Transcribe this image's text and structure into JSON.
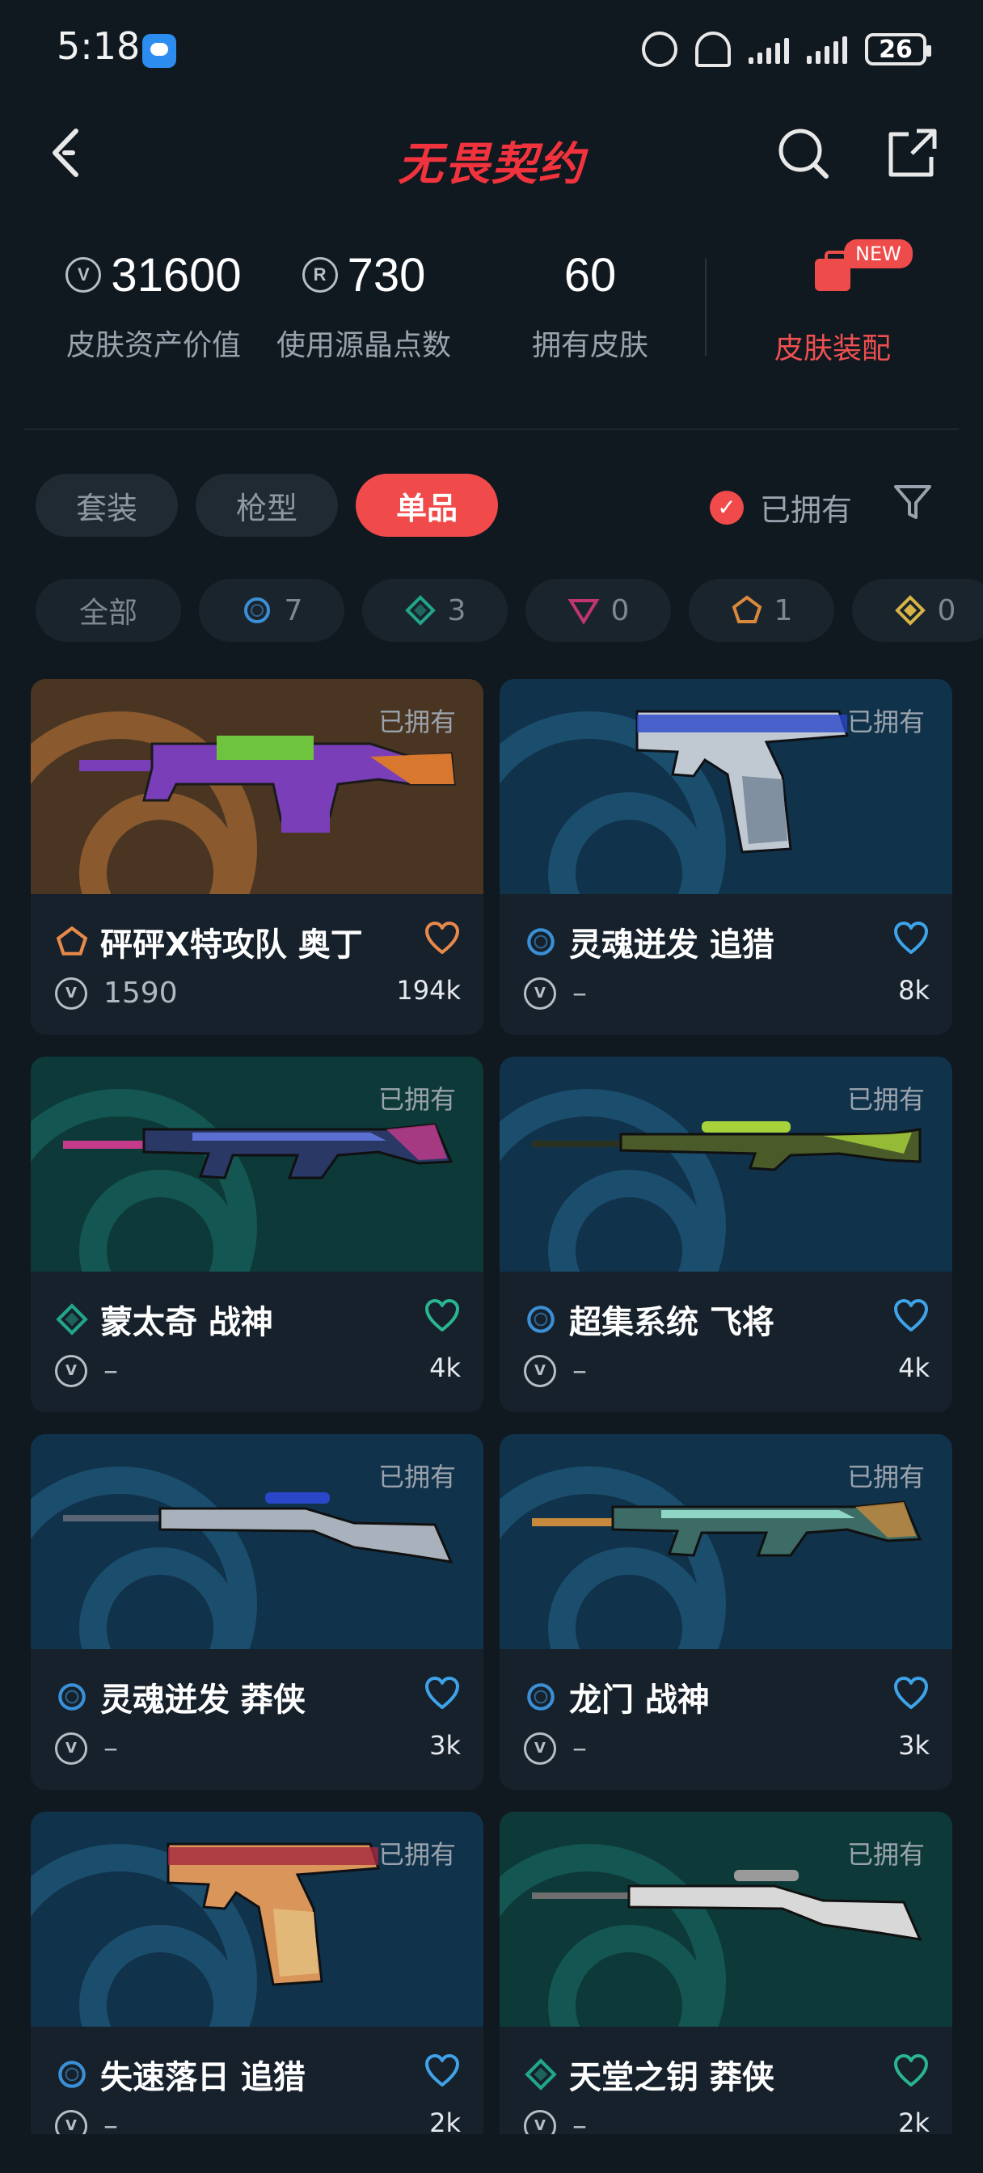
{
  "status_bar": {
    "time": "5:18",
    "battery": "26",
    "network": "3"
  },
  "header": {
    "logo": "无畏契约"
  },
  "stats": [
    {
      "value": "31600",
      "label": "皮肤资产价值",
      "icon": "valorant-points-icon"
    },
    {
      "value": "730",
      "label": "使用源晶点数",
      "icon": "radianite-icon"
    },
    {
      "value": "60",
      "label": "拥有皮肤"
    }
  ],
  "gear": {
    "label": "皮肤装配",
    "badge": "NEW"
  },
  "tabs": [
    {
      "label": "套装",
      "active": false
    },
    {
      "label": "枪型",
      "active": false
    },
    {
      "label": "单品",
      "active": true
    }
  ],
  "owned_filter": {
    "label": "已拥有",
    "checked": true
  },
  "rarity_chips": [
    {
      "label": "全部"
    },
    {
      "tier": "select",
      "count": "7",
      "color": "#3a8fd6"
    },
    {
      "tier": "deluxe",
      "count": "3",
      "color": "#21a68a"
    },
    {
      "tier": "premium",
      "count": "0",
      "color": "#c2356f"
    },
    {
      "tier": "exclusive",
      "count": "1",
      "color": "#d9883c"
    },
    {
      "tier": "ultra",
      "count": "0",
      "color": "#d8b446"
    }
  ],
  "cards": [
    {
      "name": "砰砰X特攻队 奥丁",
      "tier": "exclusive",
      "tier_color": "#e6894a",
      "price": "1590",
      "likes": "194k",
      "owned": "已拥有",
      "heart_color": "#e6894a",
      "bg": "#4a3523",
      "accent": "#8a5a2e",
      "weapon": "heavy",
      "colors": [
        "#7a3fb8",
        "#6ec43c",
        "#d8772e"
      ]
    },
    {
      "name": "灵魂迸发 追猎",
      "tier": "select",
      "tier_color": "#3a8fd6",
      "price": "–",
      "likes": "8k",
      "owned": "已拥有",
      "heart_color": "#3ea3e8",
      "bg": "#10324a",
      "accent": "#1b4d6c",
      "weapon": "pistol",
      "colors": [
        "#c0c8d2",
        "#2b47c9",
        "#8090a0"
      ]
    },
    {
      "name": "蒙太奇 战神",
      "tier": "deluxe",
      "tier_color": "#21a68a",
      "price": "–",
      "likes": "4k",
      "owned": "已拥有",
      "heart_color": "#2ab592",
      "bg": "#0d3a38",
      "accent": "#145651",
      "weapon": "rifle",
      "colors": [
        "#2a3866",
        "#5a6fd1",
        "#c43b8a"
      ]
    },
    {
      "name": "超集系统 飞将",
      "tier": "select",
      "tier_color": "#3a8fd6",
      "price": "–",
      "likes": "4k",
      "owned": "已拥有",
      "heart_color": "#3ea3e8",
      "bg": "#10324a",
      "accent": "#1b4d6c",
      "weapon": "sniper",
      "colors": [
        "#4a5a28",
        "#a8d23a",
        "#2b3220"
      ]
    },
    {
      "name": "灵魂迸发 莽侠",
      "tier": "select",
      "tier_color": "#3a8fd6",
      "price": "–",
      "likes": "3k",
      "owned": "已拥有",
      "heart_color": "#3ea3e8",
      "bg": "#10324a",
      "accent": "#1b4d6c",
      "weapon": "marshal",
      "colors": [
        "#a9b2bc",
        "#2b47c9",
        "#5a6575"
      ]
    },
    {
      "name": "龙门 战神",
      "tier": "select",
      "tier_color": "#3a8fd6",
      "price": "–",
      "likes": "3k",
      "owned": "已拥有",
      "heart_color": "#3ea3e8",
      "bg": "#10324a",
      "accent": "#1b4d6c",
      "weapon": "rifle",
      "colors": [
        "#3d6b66",
        "#8fd6c4",
        "#c78a3c"
      ]
    },
    {
      "name": "失速落日 追猎",
      "tier": "select",
      "tier_color": "#3a8fd6",
      "price": "–",
      "likes": "2k",
      "owned": "已拥有",
      "heart_color": "#3ea3e8",
      "bg": "#10324a",
      "accent": "#1b4d6c",
      "weapon": "pistol",
      "colors": [
        "#d9955a",
        "#a4283e",
        "#e2b878"
      ]
    },
    {
      "name": "天堂之钥 莽侠",
      "tier": "deluxe",
      "tier_color": "#21a68a",
      "price": "–",
      "likes": "2k",
      "owned": "已拥有",
      "heart_color": "#2ab592",
      "bg": "#0d3a38",
      "accent": "#145651",
      "weapon": "marshal",
      "colors": [
        "#d8d8d8",
        "#9a9a9a",
        "#6e6e6e"
      ]
    }
  ]
}
